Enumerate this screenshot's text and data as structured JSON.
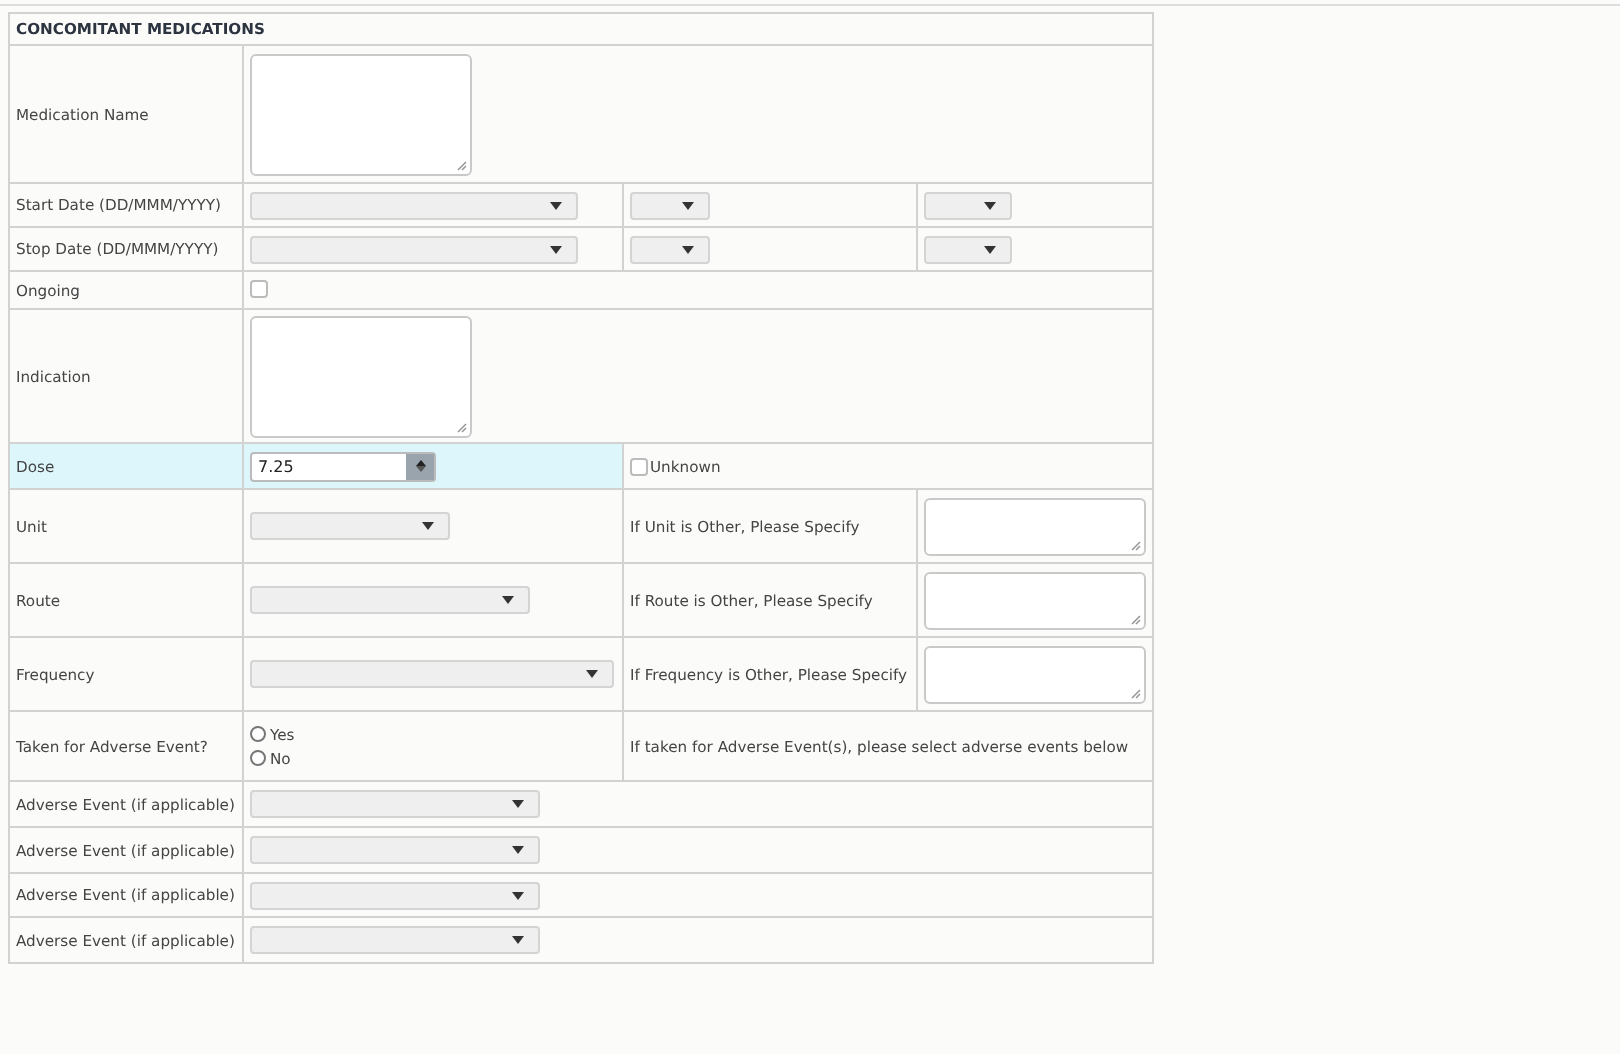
{
  "section": {
    "title": "CONCOMITANT MEDICATIONS"
  },
  "rows": [
    {
      "kind": "textarea",
      "label": "Medication Name"
    },
    {
      "kind": "date",
      "label": "Start Date (DD/MMM/YYYY)"
    },
    {
      "kind": "date",
      "label": "Stop Date (DD/MMM/YYYY)"
    },
    {
      "kind": "checkbox",
      "label": "Ongoing",
      "checked": false
    },
    {
      "kind": "textarea",
      "label": "Indication"
    },
    {
      "kind": "number",
      "label": "Dose",
      "value": "7.25",
      "highlighted": true,
      "unknown": {
        "label": "Unknown",
        "checked": false
      }
    },
    {
      "kind": "select_other",
      "label": "Unit",
      "other_label": "If Unit is Other, Please Specify"
    },
    {
      "kind": "select_other",
      "label": "Route",
      "other_label": "If Route is Other, Please Specify"
    },
    {
      "kind": "select_other",
      "label": "Frequency",
      "other_label": "If Frequency is Other, Please Specify"
    },
    {
      "kind": "radio",
      "label": "Taken for Adverse Event?",
      "options": [
        {
          "label": "Yes",
          "selected": false
        },
        {
          "label": "No",
          "selected": false
        }
      ],
      "note": "If taken for Adverse Event(s), please select adverse events below"
    },
    {
      "kind": "select",
      "label": "Adverse Event (if applicable)"
    },
    {
      "kind": "select",
      "label": "Adverse Event (if applicable)"
    },
    {
      "kind": "select",
      "label": "Adverse Event (if applicable)"
    },
    {
      "kind": "select",
      "label": "Adverse Event (if applicable)"
    }
  ]
}
